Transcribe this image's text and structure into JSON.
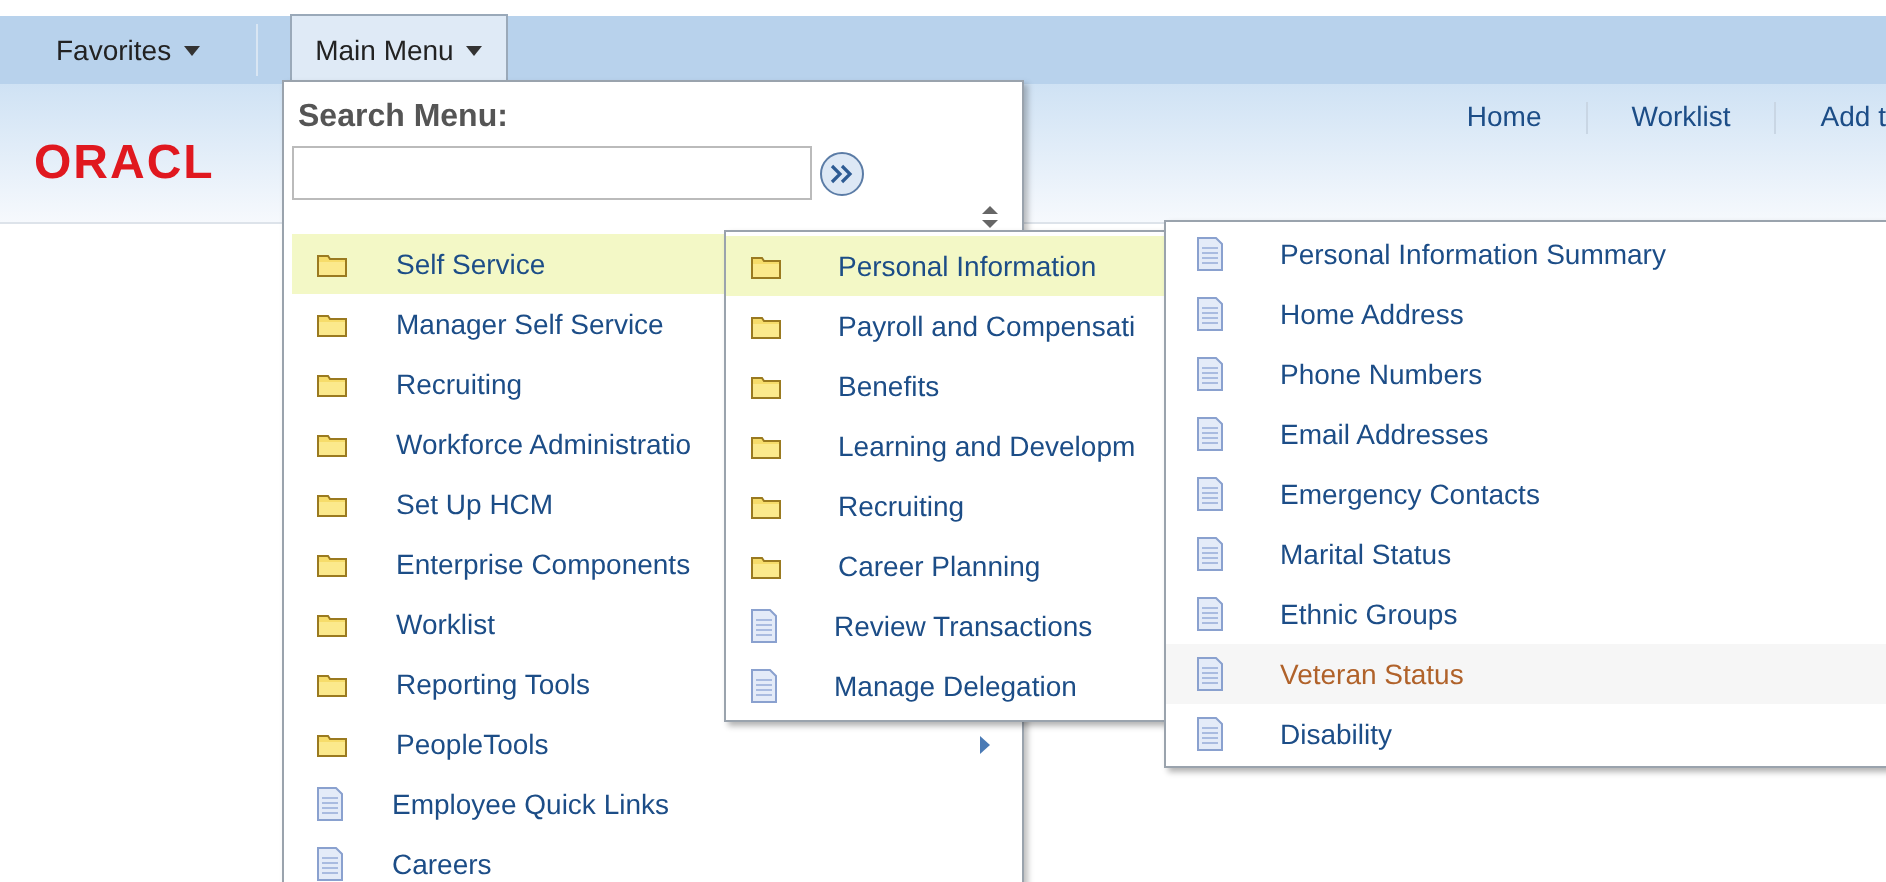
{
  "nav_bar": {
    "tabs": [
      {
        "label": "Favorites",
        "selected": false
      },
      {
        "label": "Main Menu",
        "selected": true
      }
    ]
  },
  "header": {
    "logo": "ORACL",
    "links": [
      "Home",
      "Worklist",
      "Add t"
    ]
  },
  "main_menu": {
    "search_label": "Search Menu:",
    "items": [
      {
        "label": "Self Service",
        "kind": "folder",
        "selected": true,
        "expandable": false
      },
      {
        "label": "Manager Self Service",
        "kind": "folder",
        "selected": false,
        "expandable": false
      },
      {
        "label": "Recruiting",
        "kind": "folder",
        "selected": false,
        "expandable": false
      },
      {
        "label": "Workforce Administratio",
        "kind": "folder",
        "selected": false,
        "expandable": false
      },
      {
        "label": "Set Up HCM",
        "kind": "folder",
        "selected": false,
        "expandable": false
      },
      {
        "label": "Enterprise Components",
        "kind": "folder",
        "selected": false,
        "expandable": false
      },
      {
        "label": "Worklist",
        "kind": "folder",
        "selected": false,
        "expandable": false
      },
      {
        "label": "Reporting Tools",
        "kind": "folder",
        "selected": false,
        "expandable": false
      },
      {
        "label": "PeopleTools",
        "kind": "folder",
        "selected": false,
        "expandable": true
      },
      {
        "label": "Employee Quick Links",
        "kind": "page",
        "selected": false,
        "expandable": false
      },
      {
        "label": "Careers",
        "kind": "page",
        "selected": false,
        "expandable": false
      }
    ]
  },
  "self_service_menu": {
    "items": [
      {
        "label": "Personal Information",
        "kind": "folder",
        "selected": true
      },
      {
        "label": "Payroll and Compensati",
        "kind": "folder",
        "selected": false
      },
      {
        "label": "Benefits",
        "kind": "folder",
        "selected": false
      },
      {
        "label": "Learning and Developm",
        "kind": "folder",
        "selected": false
      },
      {
        "label": "Recruiting",
        "kind": "folder",
        "selected": false
      },
      {
        "label": "Career Planning",
        "kind": "folder",
        "selected": false
      },
      {
        "label": "Review Transactions",
        "kind": "page",
        "selected": false
      },
      {
        "label": "Manage Delegation",
        "kind": "page",
        "selected": false
      }
    ]
  },
  "personal_information_menu": {
    "items": [
      {
        "label": "Personal Information Summary",
        "kind": "page",
        "hovered": false
      },
      {
        "label": "Home Address",
        "kind": "page",
        "hovered": false
      },
      {
        "label": "Phone Numbers",
        "kind": "page",
        "hovered": false
      },
      {
        "label": "Email Addresses",
        "kind": "page",
        "hovered": false
      },
      {
        "label": "Emergency Contacts",
        "kind": "page",
        "hovered": false
      },
      {
        "label": "Marital Status",
        "kind": "page",
        "hovered": false
      },
      {
        "label": "Ethnic Groups",
        "kind": "page",
        "hovered": false
      },
      {
        "label": "Veteran Status",
        "kind": "page",
        "hovered": true
      },
      {
        "label": "Disability",
        "kind": "page",
        "hovered": false
      }
    ]
  }
}
